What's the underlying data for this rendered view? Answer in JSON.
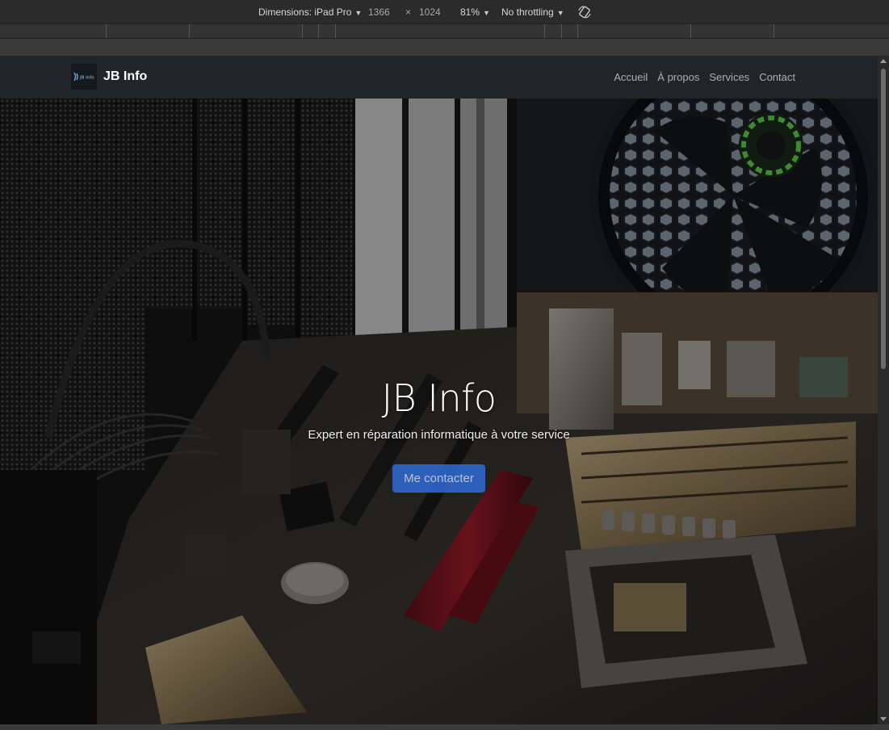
{
  "devtools": {
    "dimensions_label": "Dimensions: iPad Pro",
    "width": "1366",
    "times": "×",
    "height": "1024",
    "zoom": "81%",
    "throttling": "No throttling",
    "rotate_icon": "rotate-icon"
  },
  "navbar": {
    "brand_logo_text": "JB Info",
    "brand_name": "JB Info",
    "links": [
      "Accueil",
      "À propos",
      "Services",
      "Contact"
    ],
    "background": "#212529"
  },
  "hero": {
    "title": "JB Info",
    "subtitle": "Expert en réparation informatique à votre service",
    "button_label": "Me contacter",
    "button_color": "#2f6bd6"
  }
}
